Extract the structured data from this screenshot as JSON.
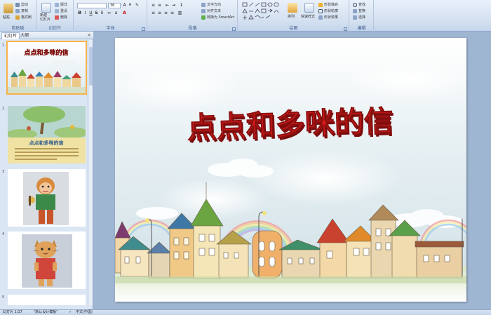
{
  "ribbon": {
    "clipboard": {
      "paste": "粘贴",
      "cut": "剪切",
      "copy": "复制",
      "format_painter": "格式刷",
      "label": "剪贴板"
    },
    "slides": {
      "new_slide": "新建\n幻灯片",
      "layout": "版式",
      "reset": "重设",
      "delete": "删除",
      "label": "幻灯片"
    },
    "font": {
      "size": "36",
      "label": "字体"
    },
    "paragraph": {
      "text_direction": "文字方向",
      "align_text": "对齐文本",
      "smartart": "转换为 SmartArt",
      "label": "段落"
    },
    "drawing": {
      "arrange": "排列",
      "quick_styles": "快速样式",
      "shape_fill": "形状填充",
      "shape_outline": "形状轮廓",
      "shape_effects": "形状效果",
      "label": "绘图"
    },
    "editing": {
      "find": "查找",
      "replace": "替换",
      "select": "选择",
      "label": "编辑"
    }
  },
  "panel": {
    "tabs": [
      "幻灯片",
      "大纲"
    ],
    "close": "×",
    "thumbs": [
      {
        "num": "1",
        "title": "点点和多咪的信"
      },
      {
        "num": "2",
        "title": "点点和多咪的信"
      },
      {
        "num": "3"
      },
      {
        "num": "4"
      },
      {
        "num": "5"
      }
    ]
  },
  "slide": {
    "title": "点点和多咪的信"
  },
  "status": {
    "slide_info": "幻灯片 1/17",
    "theme": "\"默认设计模板\"",
    "language": "中文(中国)"
  },
  "colors": {
    "title_red": "#e01b1b",
    "accent": "#f7b24a"
  }
}
